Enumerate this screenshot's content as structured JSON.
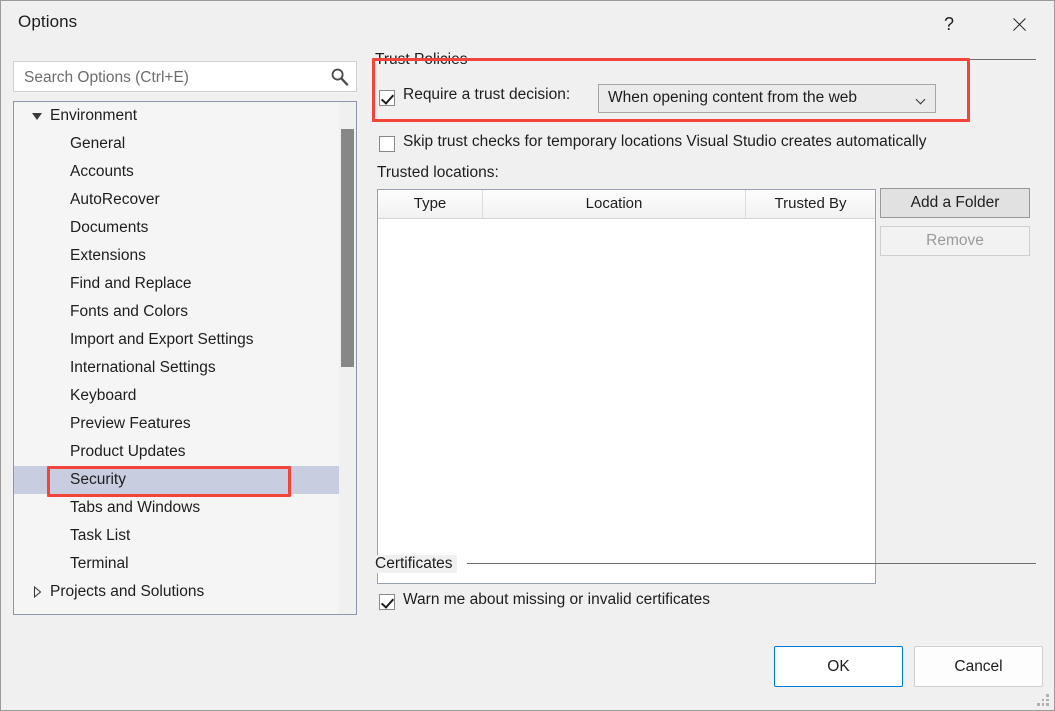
{
  "window": {
    "title": "Options",
    "help_icon": "question-mark-icon",
    "close_icon": "close-icon"
  },
  "search": {
    "placeholder": "Search Options (Ctrl+E)",
    "value": "",
    "icon": "search-icon"
  },
  "tree": {
    "items": [
      {
        "label": "Environment",
        "level": 0,
        "expanded": true,
        "selected": false
      },
      {
        "label": "General",
        "level": 1,
        "expanded": null,
        "selected": false
      },
      {
        "label": "Accounts",
        "level": 1,
        "expanded": null,
        "selected": false
      },
      {
        "label": "AutoRecover",
        "level": 1,
        "expanded": null,
        "selected": false
      },
      {
        "label": "Documents",
        "level": 1,
        "expanded": null,
        "selected": false
      },
      {
        "label": "Extensions",
        "level": 1,
        "expanded": null,
        "selected": false
      },
      {
        "label": "Find and Replace",
        "level": 1,
        "expanded": null,
        "selected": false
      },
      {
        "label": "Fonts and Colors",
        "level": 1,
        "expanded": null,
        "selected": false
      },
      {
        "label": "Import and Export Settings",
        "level": 1,
        "expanded": null,
        "selected": false
      },
      {
        "label": "International Settings",
        "level": 1,
        "expanded": null,
        "selected": false
      },
      {
        "label": "Keyboard",
        "level": 1,
        "expanded": null,
        "selected": false
      },
      {
        "label": "Preview Features",
        "level": 1,
        "expanded": null,
        "selected": false
      },
      {
        "label": "Product Updates",
        "level": 1,
        "expanded": null,
        "selected": false
      },
      {
        "label": "Security",
        "level": 1,
        "expanded": null,
        "selected": true
      },
      {
        "label": "Tabs and Windows",
        "level": 1,
        "expanded": null,
        "selected": false
      },
      {
        "label": "Task List",
        "level": 1,
        "expanded": null,
        "selected": false
      },
      {
        "label": "Terminal",
        "level": 1,
        "expanded": null,
        "selected": false
      },
      {
        "label": "Projects and Solutions",
        "level": 0,
        "expanded": false,
        "selected": false
      }
    ]
  },
  "trust_policies": {
    "group_label": "Trust Policies",
    "require_trust_decision": {
      "label": "Require a trust decision:",
      "checked": true
    },
    "trust_decision_value": "When opening content from the web",
    "trust_decision_options": [
      "When opening content from the web"
    ],
    "skip_trust_checks": {
      "label": "Skip trust checks for temporary locations Visual Studio creates automatically",
      "checked": false
    },
    "trusted_locations_label": "Trusted locations:",
    "table": {
      "columns": [
        "Type",
        "Location",
        "Trusted By"
      ],
      "rows": []
    },
    "add_folder_label": "Add a Folder",
    "remove_label": "Remove",
    "remove_disabled": true
  },
  "certificates": {
    "group_label": "Certificates",
    "warn_missing_invalid": {
      "label": "Warn me about missing or invalid certificates",
      "checked": true
    }
  },
  "footer": {
    "ok_label": "OK",
    "cancel_label": "Cancel"
  },
  "annotations": {
    "accent_color": "#f2443b",
    "highlight_color": "#c8cde0"
  }
}
